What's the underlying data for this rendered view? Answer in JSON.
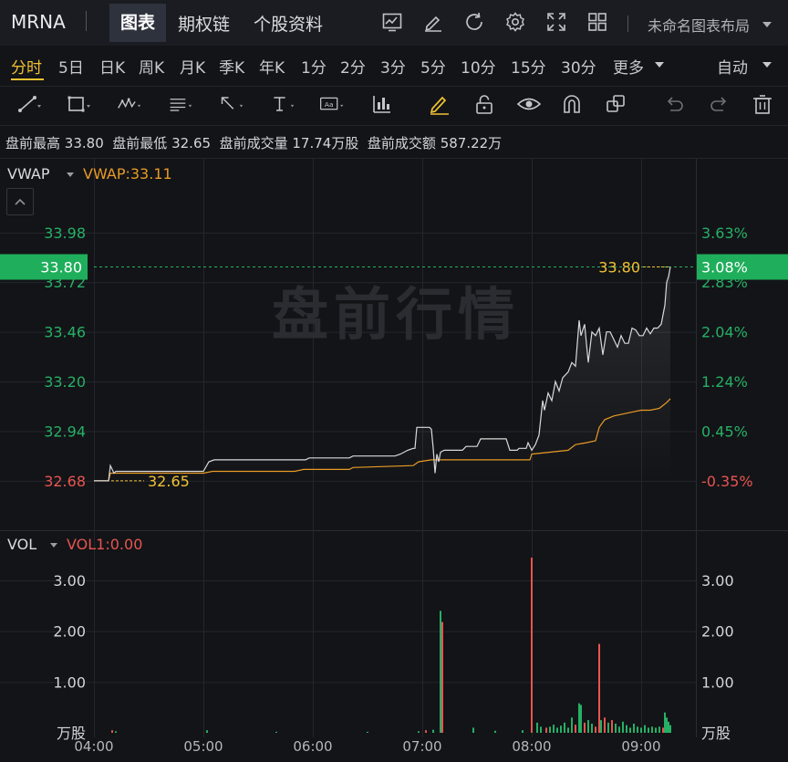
{
  "header": {
    "ticker": "MRNA",
    "tabs": [
      {
        "label": "图表",
        "active": true
      },
      {
        "label": "期权链",
        "active": false
      },
      {
        "label": "个股资料",
        "active": false
      }
    ],
    "tools": [
      "chart-indicator-icon",
      "edit-icon",
      "refresh-icon",
      "gear-icon",
      "fullscreen-icon",
      "grid-layout-icon"
    ],
    "layout_name": "未命名图表布局"
  },
  "periods": {
    "items": [
      "分时",
      "5日",
      "日K",
      "周K",
      "月K",
      "季K",
      "年K",
      "1分",
      "2分",
      "3分",
      "5分",
      "10分",
      "15分",
      "30分"
    ],
    "active": "分时",
    "more_label": "更多",
    "scale_label": "自动"
  },
  "drawing_tools": [
    "line-tool-icon",
    "rectangle-tool-icon",
    "pattern-tool-icon",
    "fibonacci-tool-icon",
    "arrow-tool-icon",
    "text-tool-icon",
    "note-tool-icon",
    "measure-tool-icon",
    "pen-icon",
    "unlock-icon",
    "eye-icon",
    "magnet-icon",
    "copy-icon",
    "undo-icon",
    "redo-icon",
    "trash-icon"
  ],
  "premarket_info": {
    "high_label": "盘前最高",
    "high_value": "33.80",
    "low_label": "盘前最低",
    "low_value": "32.65",
    "volume_label": "盘前成交量",
    "volume_value": "17.74万股",
    "amount_label": "盘前成交额",
    "amount_value": "587.22万"
  },
  "price_panel": {
    "indicator_name": "VWAP",
    "indicator_value": "VWAP:33.11",
    "watermark": "盘前行情",
    "current_price_label": "33.80",
    "current_pct_label": "3.08%",
    "high_marker": "33.80",
    "low_marker": "32.65"
  },
  "volume_panel": {
    "indicator_name": "VOL",
    "indicator_value": "VOL1:0.00"
  },
  "colors": {
    "up": "#26b065",
    "down": "#e8544f",
    "price_line": "#d9d9d9",
    "vwap_line": "#e89a25",
    "accent": "#f1c232",
    "current_price_bg": "#1fae5b"
  },
  "chart_data": [
    {
      "type": "line",
      "ylim": [
        32.62,
        34.06
      ],
      "x_ticks": [
        "04:00",
        "05:00",
        "06:00",
        "07:00",
        "08:00",
        "09:00"
      ],
      "y_ticks_left": [
        {
          "value": 33.98,
          "label": "33.98"
        },
        {
          "value": 33.72,
          "label": "33.72"
        },
        {
          "value": 33.46,
          "label": "33.46"
        },
        {
          "value": 33.2,
          "label": "33.20"
        },
        {
          "value": 32.94,
          "label": "32.94"
        },
        {
          "value": 32.68,
          "label": "32.68"
        }
      ],
      "y_ticks_right": [
        {
          "value": 33.98,
          "label": "3.63%"
        },
        {
          "value": 33.72,
          "label": "2.83%"
        },
        {
          "value": 33.46,
          "label": "2.04%"
        },
        {
          "value": 33.2,
          "label": "1.24%"
        },
        {
          "value": 32.94,
          "label": "0.45%"
        },
        {
          "value": 32.68,
          "label": "-0.35%"
        }
      ],
      "base_price": 32.795,
      "series": [
        {
          "name": "price",
          "points": [
            [
              "04:00",
              32.68
            ],
            [
              "04:08",
              32.68
            ],
            [
              "04:09",
              32.76
            ],
            [
              "04:11",
              32.72
            ],
            [
              "04:12",
              32.73
            ],
            [
              "05:00",
              32.73
            ],
            [
              "05:03",
              32.78
            ],
            [
              "05:06",
              32.79
            ],
            [
              "05:56",
              32.79
            ],
            [
              "05:58",
              32.8
            ],
            [
              "06:20",
              32.8
            ],
            [
              "06:22",
              32.81
            ],
            [
              "06:45",
              32.81
            ],
            [
              "06:48",
              32.82
            ],
            [
              "06:52",
              32.84
            ],
            [
              "06:55",
              32.85
            ],
            [
              "06:56",
              32.85
            ],
            [
              "06:57",
              32.96
            ],
            [
              "07:04",
              32.96
            ],
            [
              "07:05",
              32.95
            ],
            [
              "07:06",
              32.85
            ],
            [
              "07:07",
              32.72
            ],
            [
              "07:08",
              32.82
            ],
            [
              "07:09",
              32.78
            ],
            [
              "07:10",
              32.83
            ],
            [
              "07:12",
              32.84
            ],
            [
              "07:22",
              32.84
            ],
            [
              "07:24",
              32.86
            ],
            [
              "07:30",
              32.86
            ],
            [
              "07:32",
              32.9
            ],
            [
              "07:46",
              32.9
            ],
            [
              "07:48",
              32.84
            ],
            [
              "07:52",
              32.84
            ],
            [
              "07:53",
              32.85
            ],
            [
              "07:57",
              32.85
            ],
            [
              "07:58",
              32.88
            ],
            [
              "08:00",
              32.84
            ],
            [
              "08:02",
              32.87
            ],
            [
              "08:04",
              32.92
            ],
            [
              "08:06",
              33.1
            ],
            [
              "08:07",
              33.05
            ],
            [
              "08:09",
              33.14
            ],
            [
              "08:11",
              33.1
            ],
            [
              "08:13",
              33.2
            ],
            [
              "08:15",
              33.15
            ],
            [
              "08:17",
              33.22
            ],
            [
              "08:20",
              33.25
            ],
            [
              "08:22",
              33.3
            ],
            [
              "08:24",
              33.28
            ],
            [
              "08:26",
              33.52
            ],
            [
              "08:27",
              33.44
            ],
            [
              "08:29",
              33.5
            ],
            [
              "08:31",
              33.3
            ],
            [
              "08:33",
              33.46
            ],
            [
              "08:35",
              33.44
            ],
            [
              "08:37",
              33.48
            ],
            [
              "08:39",
              33.34
            ],
            [
              "08:41",
              33.46
            ],
            [
              "08:43",
              33.46
            ],
            [
              "08:45",
              33.42
            ],
            [
              "08:47",
              33.38
            ],
            [
              "08:49",
              33.44
            ],
            [
              "08:51",
              33.4
            ],
            [
              "08:53",
              33.4
            ],
            [
              "08:55",
              33.48
            ],
            [
              "08:57",
              33.47
            ],
            [
              "08:59",
              33.44
            ],
            [
              "09:01",
              33.44
            ],
            [
              "09:03",
              33.48
            ],
            [
              "09:05",
              33.45
            ],
            [
              "09:07",
              33.48
            ],
            [
              "09:09",
              33.48
            ],
            [
              "09:11",
              33.5
            ],
            [
              "09:13",
              33.6
            ],
            [
              "09:14",
              33.72
            ],
            [
              "09:15",
              33.75
            ],
            [
              "09:16",
              33.8
            ]
          ]
        },
        {
          "name": "VWAP",
          "points": [
            [
              "04:00",
              32.68
            ],
            [
              "04:08",
              32.68
            ],
            [
              "04:09",
              32.72
            ],
            [
              "04:12",
              32.72
            ],
            [
              "05:00",
              32.72
            ],
            [
              "05:05",
              32.73
            ],
            [
              "05:50",
              32.73
            ],
            [
              "05:55",
              32.74
            ],
            [
              "06:20",
              32.74
            ],
            [
              "06:22",
              32.75
            ],
            [
              "06:55",
              32.76
            ],
            [
              "06:58",
              32.78
            ],
            [
              "07:05",
              32.79
            ],
            [
              "07:12",
              32.79
            ],
            [
              "07:35",
              32.79
            ],
            [
              "07:59",
              32.79
            ],
            [
              "08:00",
              32.82
            ],
            [
              "08:10",
              32.83
            ],
            [
              "08:20",
              32.84
            ],
            [
              "08:24",
              32.87
            ],
            [
              "08:30",
              32.88
            ],
            [
              "08:35",
              32.89
            ],
            [
              "08:37",
              32.96
            ],
            [
              "08:40",
              33.0
            ],
            [
              "08:45",
              33.02
            ],
            [
              "08:50",
              33.03
            ],
            [
              "08:55",
              33.04
            ],
            [
              "09:00",
              33.05
            ],
            [
              "09:05",
              33.05
            ],
            [
              "09:10",
              33.06
            ],
            [
              "09:14",
              33.09
            ],
            [
              "09:16",
              33.11
            ]
          ]
        }
      ]
    },
    {
      "type": "bar",
      "unit": "万股",
      "ylim": [
        0,
        3.5
      ],
      "x_ticks": [
        "04:00",
        "05:00",
        "06:00",
        "07:00",
        "08:00",
        "09:00"
      ],
      "y_ticks": [
        {
          "value": 3.0,
          "label": "3.00"
        },
        {
          "value": 2.0,
          "label": "2.00"
        },
        {
          "value": 1.0,
          "label": "1.00"
        }
      ],
      "bars": [
        {
          "t": "04:10",
          "v": 0.05,
          "dir": "down"
        },
        {
          "t": "04:12",
          "v": 0.03,
          "dir": "up"
        },
        {
          "t": "05:02",
          "v": 0.05,
          "dir": "up"
        },
        {
          "t": "05:40",
          "v": 0.02,
          "dir": "up"
        },
        {
          "t": "06:30",
          "v": 0.02,
          "dir": "up"
        },
        {
          "t": "06:58",
          "v": 0.03,
          "dir": "up"
        },
        {
          "t": "07:02",
          "v": 0.05,
          "dir": "down"
        },
        {
          "t": "07:06",
          "v": 0.06,
          "dir": "up"
        },
        {
          "t": "07:10",
          "v": 2.4,
          "dir": "up"
        },
        {
          "t": "07:11",
          "v": 2.18,
          "dir": "down"
        },
        {
          "t": "07:28",
          "v": 0.1,
          "dir": "up"
        },
        {
          "t": "07:40",
          "v": 0.04,
          "dir": "up"
        },
        {
          "t": "07:55",
          "v": 0.05,
          "dir": "up"
        },
        {
          "t": "08:00",
          "v": 3.45,
          "dir": "down"
        },
        {
          "t": "08:03",
          "v": 0.2,
          "dir": "up"
        },
        {
          "t": "08:05",
          "v": 0.12,
          "dir": "up"
        },
        {
          "t": "08:08",
          "v": 0.1,
          "dir": "down"
        },
        {
          "t": "08:10",
          "v": 0.12,
          "dir": "up"
        },
        {
          "t": "08:12",
          "v": 0.16,
          "dir": "up"
        },
        {
          "t": "08:14",
          "v": 0.1,
          "dir": "up"
        },
        {
          "t": "08:16",
          "v": 0.14,
          "dir": "up"
        },
        {
          "t": "08:18",
          "v": 0.2,
          "dir": "up"
        },
        {
          "t": "08:20",
          "v": 0.1,
          "dir": "up"
        },
        {
          "t": "08:22",
          "v": 0.3,
          "dir": "up"
        },
        {
          "t": "08:24",
          "v": 0.16,
          "dir": "down"
        },
        {
          "t": "08:26",
          "v": 0.58,
          "dir": "up"
        },
        {
          "t": "08:27",
          "v": 0.55,
          "dir": "up"
        },
        {
          "t": "08:29",
          "v": 0.2,
          "dir": "down"
        },
        {
          "t": "08:31",
          "v": 0.25,
          "dir": "up"
        },
        {
          "t": "08:33",
          "v": 0.18,
          "dir": "up"
        },
        {
          "t": "08:35",
          "v": 0.12,
          "dir": "down"
        },
        {
          "t": "08:37",
          "v": 1.75,
          "dir": "down"
        },
        {
          "t": "08:38",
          "v": 0.25,
          "dir": "up"
        },
        {
          "t": "08:40",
          "v": 0.3,
          "dir": "down"
        },
        {
          "t": "08:42",
          "v": 0.2,
          "dir": "up"
        },
        {
          "t": "08:44",
          "v": 0.25,
          "dir": "down"
        },
        {
          "t": "08:46",
          "v": 0.18,
          "dir": "up"
        },
        {
          "t": "08:48",
          "v": 0.12,
          "dir": "up"
        },
        {
          "t": "08:50",
          "v": 0.22,
          "dir": "up"
        },
        {
          "t": "08:52",
          "v": 0.15,
          "dir": "up"
        },
        {
          "t": "08:54",
          "v": 0.1,
          "dir": "up"
        },
        {
          "t": "08:56",
          "v": 0.18,
          "dir": "up"
        },
        {
          "t": "08:58",
          "v": 0.12,
          "dir": "up"
        },
        {
          "t": "09:00",
          "v": 0.1,
          "dir": "up"
        },
        {
          "t": "09:02",
          "v": 0.15,
          "dir": "up"
        },
        {
          "t": "09:04",
          "v": 0.1,
          "dir": "up"
        },
        {
          "t": "09:06",
          "v": 0.12,
          "dir": "up"
        },
        {
          "t": "09:08",
          "v": 0.1,
          "dir": "up"
        },
        {
          "t": "09:10",
          "v": 0.12,
          "dir": "up"
        },
        {
          "t": "09:12",
          "v": 0.1,
          "dir": "down"
        },
        {
          "t": "09:13",
          "v": 0.4,
          "dir": "up"
        },
        {
          "t": "09:14",
          "v": 0.3,
          "dir": "up"
        },
        {
          "t": "09:15",
          "v": 0.22,
          "dir": "up"
        },
        {
          "t": "09:16",
          "v": 0.15,
          "dir": "up"
        }
      ]
    }
  ]
}
